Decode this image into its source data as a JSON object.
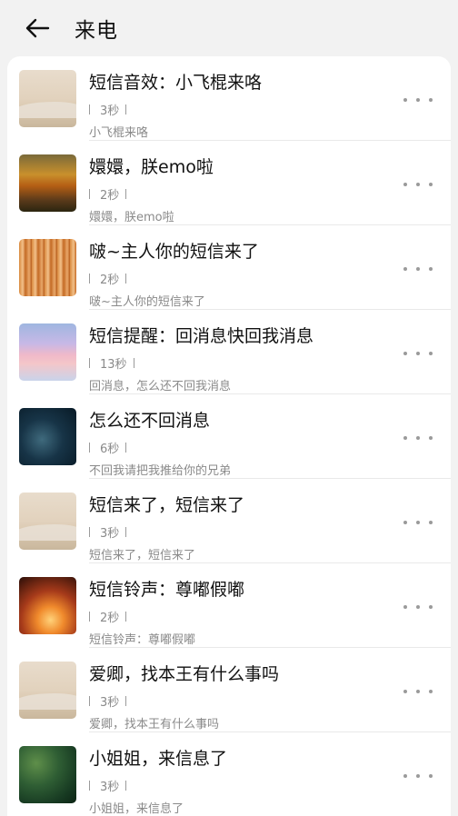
{
  "header": {
    "title": "来电"
  },
  "items": [
    {
      "name": "短信音效：小飞棍来咯",
      "duration": "3秒",
      "desc": "小飞棍来咯",
      "thumb": "beige"
    },
    {
      "name": "嬛嬛，朕emo啦",
      "duration": "2秒",
      "desc": "嬛嬛，朕emo啦",
      "thumb": "forest"
    },
    {
      "name": "啵~主人你的短信来了",
      "duration": "2秒",
      "desc": "啵~主人你的短信来了",
      "thumb": "wood"
    },
    {
      "name": "短信提醒：回消息快回我消息",
      "duration": "13秒",
      "desc": "回消息，怎么还不回我消息",
      "thumb": "pink"
    },
    {
      "name": "怎么还不回消息",
      "duration": "6秒",
      "desc": "不回我请把我推给你的兄弟",
      "thumb": "night"
    },
    {
      "name": "短信来了，短信来了",
      "duration": "3秒",
      "desc": "短信来了，短信来了",
      "thumb": "beige"
    },
    {
      "name": "短信铃声：尊嘟假嘟",
      "duration": "2秒",
      "desc": "短信铃声：尊嘟假嘟",
      "thumb": "fire"
    },
    {
      "name": "爱卿，找本王有什么事吗",
      "duration": "3秒",
      "desc": "爱卿，找本王有什么事吗",
      "thumb": "beige"
    },
    {
      "name": "小姐姐，来信息了",
      "duration": "3秒",
      "desc": "小姐姐，来信息了",
      "thumb": "green"
    }
  ],
  "icons": {
    "back": "arrow-left-icon",
    "more": "more-horizontal-icon"
  },
  "colors": {
    "background": "#f2f2f2",
    "card": "#ffffff",
    "secondary_text": "#8a8a8a"
  }
}
